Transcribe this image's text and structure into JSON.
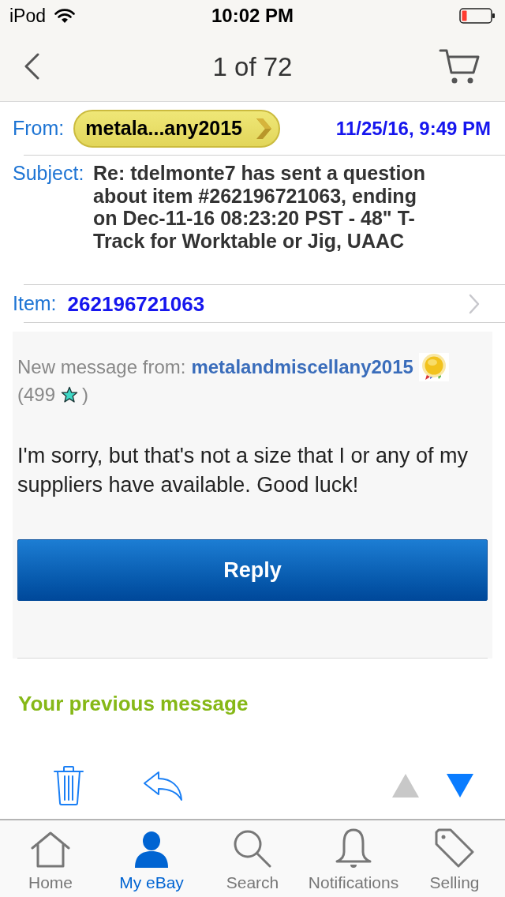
{
  "status_bar": {
    "carrier": "iPod",
    "time": "10:02 PM"
  },
  "nav": {
    "title": "1 of 72"
  },
  "header": {
    "from_label": "From:",
    "sender": "metala...any2015",
    "date": "11/25/16, 9:49 PM",
    "subject_label": "Subject:",
    "subject": "Re: tdelmonte7 has sent a question about item #262196721063, ending on Dec-11-16 08:23:20 PST - 48\" T-Track for Worktable or Jig, UAAC",
    "item_label": "Item:",
    "item_number": "262196721063"
  },
  "message": {
    "intro": "New message from:",
    "username": "metalandmiscellany2015",
    "feedback_open": "(499",
    "feedback_close": ")",
    "body": "I'm sorry, but that's not a size that I or any of my suppliers have available. Good luck!",
    "reply_button": "Reply"
  },
  "previous": {
    "heading": "Your previous message"
  },
  "toolbar": {
    "up_disabled": true,
    "down_disabled": false
  },
  "tabs": [
    {
      "label": "Home",
      "kind": "home",
      "selected": false
    },
    {
      "label": "My eBay",
      "kind": "profile",
      "selected": true
    },
    {
      "label": "Search",
      "kind": "search",
      "selected": false
    },
    {
      "label": "Notifications",
      "kind": "bell",
      "selected": false
    },
    {
      "label": "Selling",
      "kind": "tag",
      "selected": false
    }
  ]
}
